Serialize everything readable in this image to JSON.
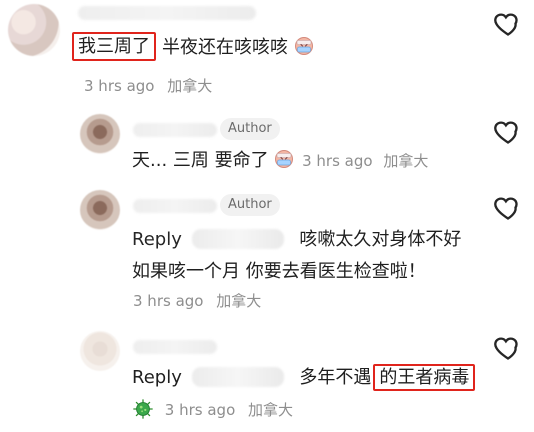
{
  "comments": [
    {
      "type": "comment",
      "prefix_highlighted": "我三周了",
      "text": "半夜还在咳咳咳",
      "emoji": "face-with-bandage-emoji",
      "time": "3 hrs ago",
      "location": "加拿大"
    },
    {
      "type": "reply",
      "badge": "Author",
      "text": "天... 三周 要命了",
      "emoji": "face-with-bandage-emoji",
      "time": "3 hrs ago",
      "location": "加拿大"
    },
    {
      "type": "reply",
      "badge": "Author",
      "reply_label": "Reply",
      "line1": "咳嗽太久对身体不好",
      "line2": "如果咳一个月 你要去看医生检查啦！",
      "time": "3 hrs ago",
      "location": "加拿大"
    },
    {
      "type": "reply",
      "reply_label": "Reply",
      "text_plain": "多年不遇",
      "text_highlighted": "的王者病毒",
      "emoji": "microbe-emoji",
      "time": "3 hrs ago",
      "location": "加拿大"
    }
  ],
  "colors": {
    "highlight_border": "#e0241c",
    "meta_text": "#8e8e8e",
    "badge_bg": "#f1f1f1",
    "body_text": "#1f1f1f"
  }
}
